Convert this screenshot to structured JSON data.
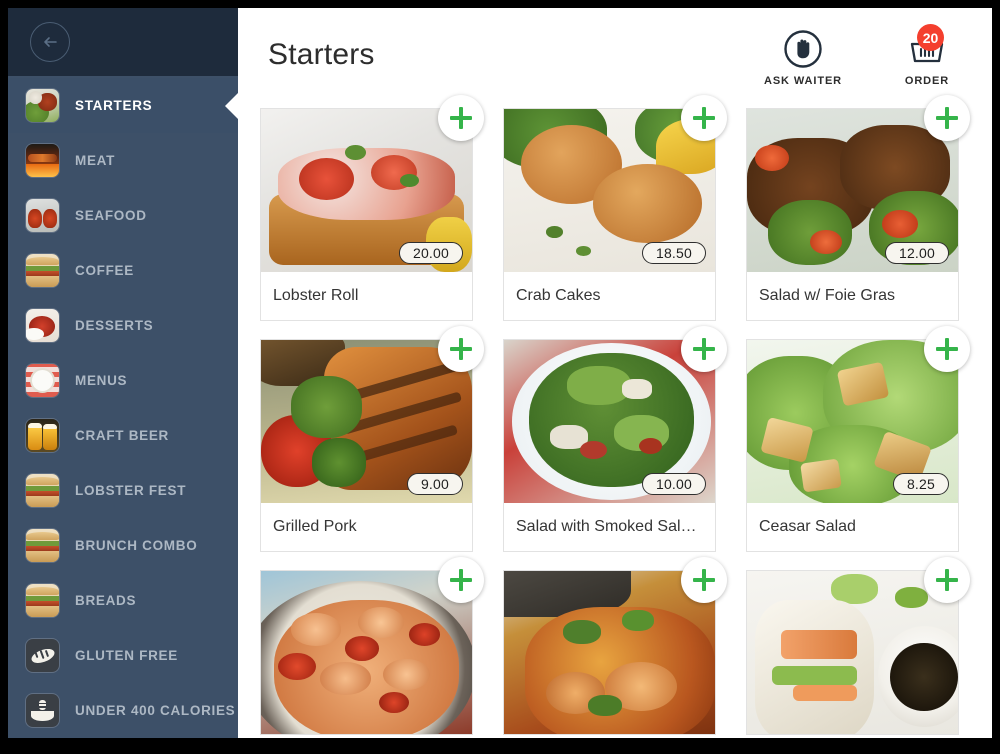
{
  "sidebar": {
    "back_button": "back-arrow",
    "items": [
      {
        "label": "STARTERS",
        "icon": "salad-thumb",
        "active": true
      },
      {
        "label": "MEAT",
        "icon": "grill-meat-thumb",
        "active": false
      },
      {
        "label": "SEAFOOD",
        "icon": "lobster-thumb",
        "active": false
      },
      {
        "label": "COFFEE",
        "icon": "sandwich-thumb",
        "active": false
      },
      {
        "label": "DESSERTS",
        "icon": "dessert-thumb",
        "active": false
      },
      {
        "label": "MENUS",
        "icon": "plate-checker-thumb",
        "active": false
      },
      {
        "label": "CRAFT BEER",
        "icon": "beer-thumb",
        "active": false
      },
      {
        "label": "LOBSTER FEST",
        "icon": "sandwich-thumb",
        "active": false
      },
      {
        "label": "BRUNCH COMBO",
        "icon": "sandwich-thumb",
        "active": false
      },
      {
        "label": "BREADS",
        "icon": "sandwich-thumb",
        "active": false
      },
      {
        "label": "GLUTEN FREE",
        "icon": "bread-loaf-icon",
        "active": false
      },
      {
        "label": "UNDER 400 CALORIES",
        "icon": "calorie-bowl-icon",
        "active": false
      }
    ]
  },
  "header": {
    "title": "Starters",
    "ask_waiter": {
      "label": "ASK WAITER",
      "icon": "raised-hand-icon"
    },
    "order": {
      "label": "ORDER",
      "icon": "shopping-basket-icon",
      "badge": "20"
    }
  },
  "menu": {
    "items": [
      {
        "name": "Lobster Roll",
        "price": "20.00",
        "image": "lobster-roll-photo"
      },
      {
        "name": "Crab Cakes",
        "price": "18.50",
        "image": "crab-cakes-photo"
      },
      {
        "name": "Salad w/ Foie Gras",
        "price": "12.00",
        "image": "foie-gras-salad-photo"
      },
      {
        "name": "Grilled Pork",
        "price": "9.00",
        "image": "grilled-pork-photo"
      },
      {
        "name": "Salad with Smoked Sal…",
        "price": "10.00",
        "image": "smoked-salmon-salad-photo"
      },
      {
        "name": "Ceasar Salad",
        "price": "8.25",
        "image": "ceasar-salad-photo"
      },
      {
        "name": "",
        "price": "",
        "image": "shrimp-skillet-photo"
      },
      {
        "name": "",
        "price": "",
        "image": "shrimp-curry-photo"
      },
      {
        "name": "",
        "price": "",
        "image": "spring-roll-photo"
      }
    ]
  },
  "colors": {
    "sidebar_bg": "#3d5068",
    "sidebar_header_bg": "#1e2b3c",
    "accent_green": "#35b44a",
    "badge_red": "#f43f2e",
    "page_bg": "#ffffff"
  }
}
